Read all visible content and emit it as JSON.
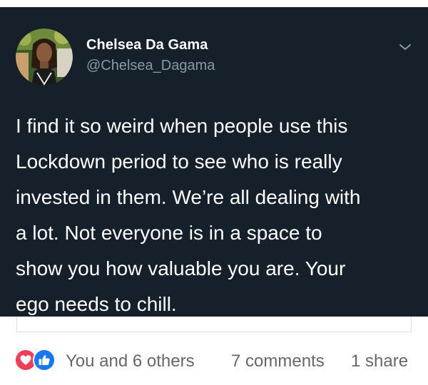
{
  "tweet": {
    "display_name": "Chelsea Da Gama",
    "handle": "@Chelsea_Dagama",
    "text_lines": [
      "I find it so weird when people use this",
      "Lockdown period to see who is really",
      "invested in them. We’re all dealing with",
      "a lot. Not everyone is in a space to",
      "show you how valuable you are. Your",
      "ego needs to chill."
    ],
    "icons": {
      "menu": "chevron-down-icon",
      "avatar": "avatar-photo"
    }
  },
  "reactions": {
    "icons": [
      "love-reaction-icon",
      "like-reaction-icon"
    ],
    "reactors_text": "You and 6 others",
    "comments_text": "7 comments",
    "shares_text": "1 share"
  },
  "colors": {
    "tweet_background": "#15202b",
    "tweet_text": "#ffffff",
    "handle_text": "#8899a6",
    "meta_text": "#65676b",
    "love_red": "#f33e58",
    "like_blue": "#1877f2"
  }
}
